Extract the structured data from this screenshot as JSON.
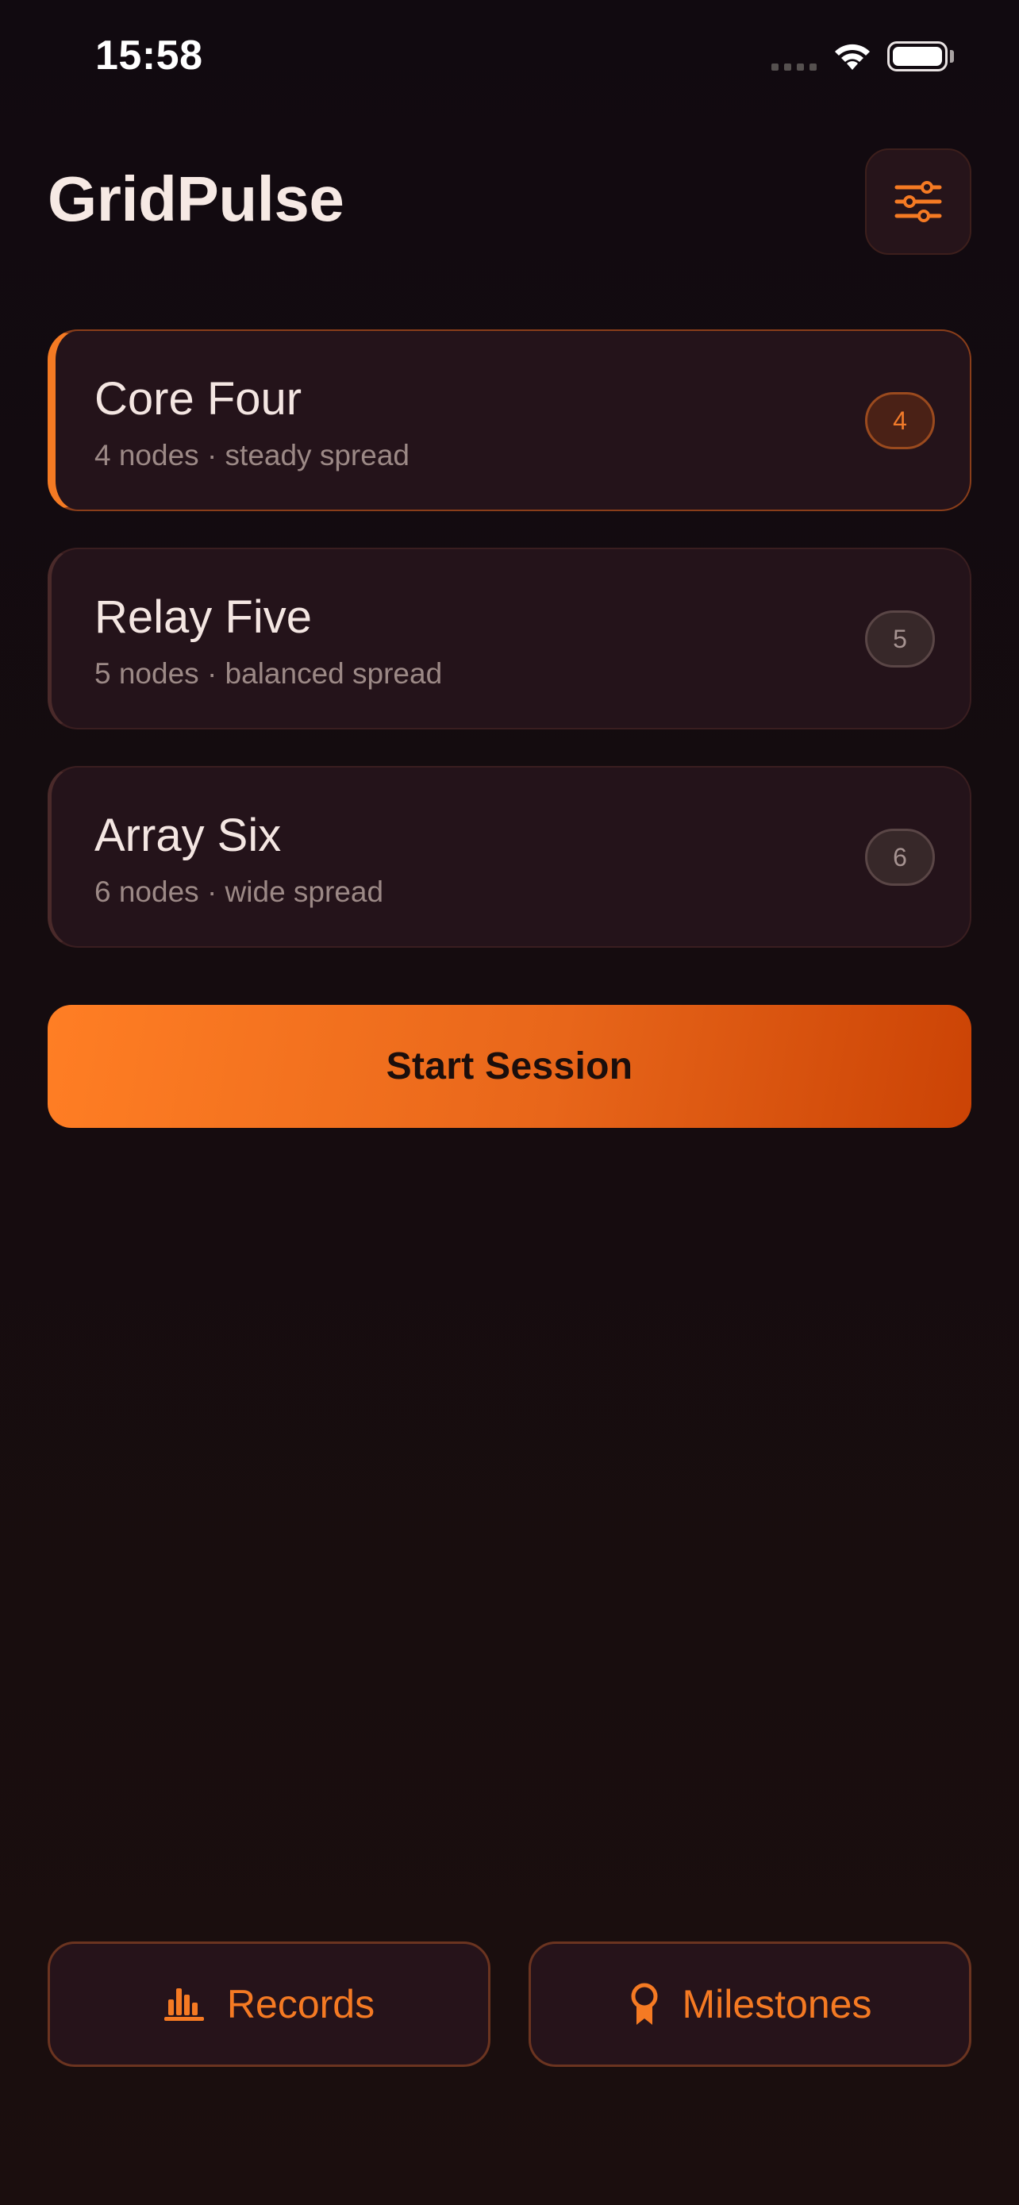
{
  "status_bar": {
    "time": "15:58"
  },
  "header": {
    "title": "GridPulse",
    "settings_icon": "sliders-icon"
  },
  "presets": [
    {
      "name": "Core Four",
      "description": "4 nodes · steady spread",
      "badge": "4",
      "selected": true
    },
    {
      "name": "Relay Five",
      "description": "5 nodes · balanced spread",
      "badge": "5",
      "selected": false
    },
    {
      "name": "Array Six",
      "description": "6 nodes · wide spread",
      "badge": "6",
      "selected": false
    }
  ],
  "start_button": {
    "label": "Start Session"
  },
  "bottom_nav": {
    "records_label": "Records",
    "records_icon": "bar-chart-icon",
    "milestones_label": "Milestones",
    "milestones_icon": "award-ribbon-icon"
  },
  "colors": {
    "accent": "#f57a23",
    "accent_dark": "#cb4305",
    "background": "#130b0f",
    "card": "#24131a",
    "text_primary": "#f4e6e2",
    "text_secondary": "#9c8986"
  }
}
